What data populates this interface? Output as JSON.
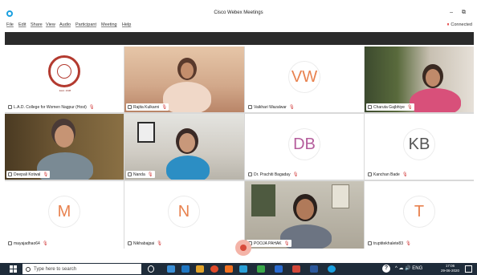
{
  "window": {
    "title": "Cisco Webex Meetings",
    "min": "–",
    "restore": "⧉"
  },
  "menu": {
    "items": [
      "File",
      "Edit",
      "Share",
      "View",
      "Audio",
      "Participant",
      "Meeting",
      "Help"
    ],
    "status": "Connected"
  },
  "participants": [
    {
      "name": "L.A.D. College for Women Nagpur (Host)",
      "type": "emblem",
      "emblem_caption": "Estd. 1938"
    },
    {
      "name": "Rajita Kulkarni",
      "type": "video",
      "active": true
    },
    {
      "name": "Vaikhari Wazalwar",
      "type": "avatar",
      "initials": "VW"
    },
    {
      "name": "Charuta Gajbhiye",
      "type": "video"
    },
    {
      "name": "Deepali Kotwal",
      "type": "video"
    },
    {
      "name": "Nanda",
      "type": "video"
    },
    {
      "name": "Dr. Prachiti Bagaday",
      "type": "avatar",
      "initials": "DB"
    },
    {
      "name": "Kanchan Bade",
      "type": "avatar",
      "initials": "KB"
    },
    {
      "name": "mayajadhao64",
      "type": "avatar",
      "initials": "M"
    },
    {
      "name": "Nikhabajpai",
      "type": "avatar",
      "initials": "N"
    },
    {
      "name": "POOJA PAHAK",
      "type": "video",
      "active": true
    },
    {
      "name": "truptitekhalete83",
      "type": "avatar",
      "initials": "T"
    }
  ],
  "taskbar": {
    "search_placeholder": "Type here to search",
    "help": "?",
    "tray": "^ ☁ 🔊 ENG",
    "time": "17:06",
    "date": "29-06-2020"
  }
}
